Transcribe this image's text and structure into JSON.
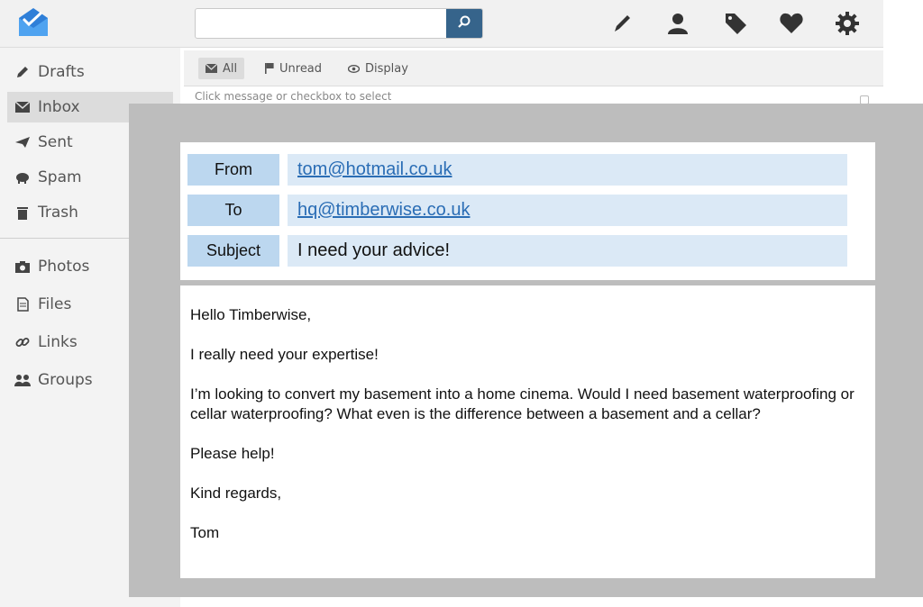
{
  "search": {
    "placeholder": "",
    "value": ""
  },
  "icons": {
    "logo": "inbox-tray-logo-icon",
    "search": "search-icon",
    "top": [
      "compose-pencil-icon",
      "contacts-person-icon",
      "tag-icon",
      "favorites-heart-icon",
      "settings-gear-icon"
    ]
  },
  "sidebar": {
    "items": [
      {
        "label": "Drafts",
        "icon": "pencil-icon"
      },
      {
        "label": "Inbox",
        "icon": "envelope-icon",
        "active": true
      },
      {
        "label": "Sent",
        "icon": "paper-plane-icon"
      },
      {
        "label": "Spam",
        "icon": "piggy-bank-icon"
      },
      {
        "label": "Trash",
        "icon": "trash-icon"
      },
      {
        "label": "Photos",
        "icon": "camera-icon"
      },
      {
        "label": "Files",
        "icon": "file-icon"
      },
      {
        "label": "Links",
        "icon": "link-icon"
      },
      {
        "label": "Groups",
        "icon": "group-icon"
      }
    ]
  },
  "list": {
    "filters": [
      {
        "label": "All",
        "icon": "envelope-icon",
        "active": true
      },
      {
        "label": "Unread",
        "icon": "flag-icon"
      },
      {
        "label": "Display",
        "icon": "eye-icon"
      }
    ],
    "hint": "Click message or checkbox to select"
  },
  "email": {
    "from_label": "From",
    "from_value": "tom@hotmail.co.uk",
    "to_label": "To",
    "to_value": "hq@timberwise.co.uk",
    "subject_label": "Subject",
    "subject_value": "I need your advice!",
    "body": [
      "Hello Timberwise,",
      "I really need your expertise!",
      "I’m looking to convert my basement into a home cinema. Would I need basement waterproofing or cellar waterproofing? What even is the difference between a basement and a cellar?",
      "Please help!",
      "Kind regards,",
      "Tom"
    ]
  },
  "colors": {
    "accent": "#36648b",
    "label_bg": "#bcd7ef",
    "value_bg": "#dbe9f6",
    "overlay_bg": "#bdbdbd",
    "link": "#2a6db5",
    "logo_blue": "#2f7fd8"
  }
}
